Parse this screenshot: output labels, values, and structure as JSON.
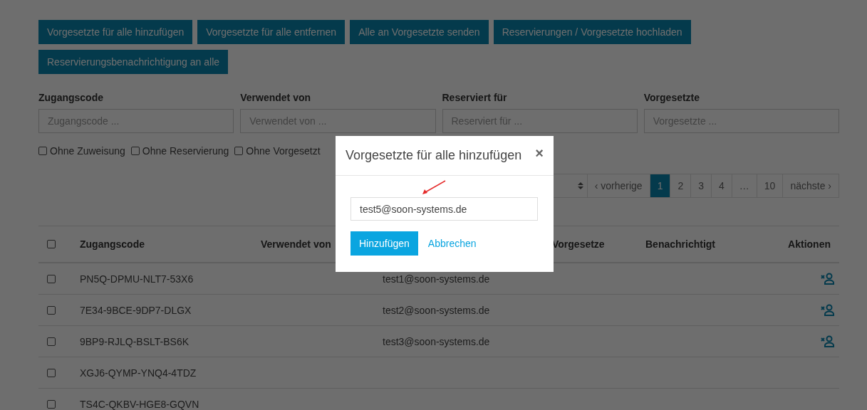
{
  "toolbar_buttons": [
    "Vorgesetzte für alle hinzufügen",
    "Vorgesetzte für alle entfernen",
    "Alle an Vorgesetzte senden",
    "Reservierungen / Vorgesetzte hochladen",
    "Reservierungsbenachrichtigung an alle"
  ],
  "filters": [
    {
      "label": "Zugangscode",
      "placeholder": "Zugangscode ..."
    },
    {
      "label": "Verwendet von",
      "placeholder": "Verwendet von ..."
    },
    {
      "label": "Reserviert für",
      "placeholder": "Reserviert für ..."
    },
    {
      "label": "Vorgesetzte",
      "placeholder": "Vorgesetzte ..."
    }
  ],
  "filter_checkboxes": [
    {
      "label": "Ohne Zuweisung",
      "checked": false
    },
    {
      "label": "Ohne Reservierung",
      "checked": false
    },
    {
      "label": "Ohne Vorgesetzt",
      "checked": false
    }
  ],
  "pagination": [
    {
      "label": "‹ vorherige",
      "selected": false
    },
    {
      "label": "1",
      "selected": true
    },
    {
      "label": "2",
      "selected": false
    },
    {
      "label": "3",
      "selected": false
    },
    {
      "label": "4",
      "selected": false
    },
    {
      "label": "…",
      "selected": false
    },
    {
      "label": "10",
      "selected": false
    },
    {
      "label": "nächste ›",
      "selected": false
    }
  ],
  "table": {
    "header_checked": false,
    "columns": [
      "Zugangscode",
      "Verwendet von",
      "",
      "Vorgesetze",
      "Benachrichtigt",
      "Aktionen"
    ],
    "rows": [
      {
        "checked": false,
        "code": "PN5Q-DPMU-NLT7-53X6",
        "email": "test1@soon-systems.de",
        "action": true
      },
      {
        "checked": false,
        "code": "7E34-9BCE-9DP7-DLGX",
        "email": "test2@soon-systems.de",
        "action": true
      },
      {
        "checked": false,
        "code": "9BP9-RJLQ-BSLT-BS6K",
        "email": "test3@soon-systems.de",
        "action": true
      },
      {
        "checked": false,
        "code": "XGJ6-QYMP-YNQ4-4TDZ",
        "action": false
      },
      {
        "checked": false,
        "code": "TS4C-QKBV-HGE8-GQVN",
        "action": false
      }
    ]
  },
  "dialog": {
    "title": "Vorgesetzte für alle hinzufügen",
    "close": "×",
    "value": "test5@soon-systems.de",
    "buttons": [
      {
        "kind": "primary",
        "label": "Hinzufügen"
      },
      {
        "kind": "link",
        "label": "Abbrechen"
      }
    ]
  }
}
